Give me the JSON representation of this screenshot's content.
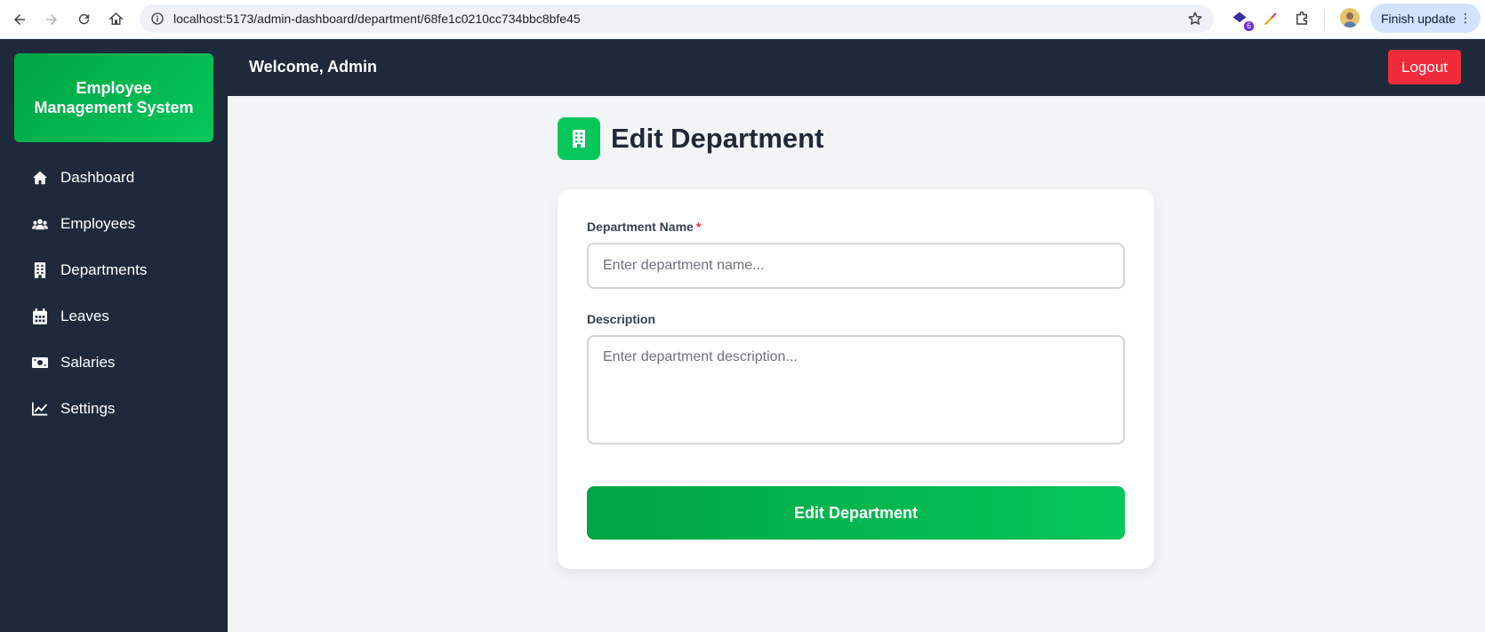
{
  "browser": {
    "url": "localhost:5173/admin-dashboard/department/68fe1c0210cc734bbc8bfe45",
    "extension_badge": "6",
    "update_button": "Finish update"
  },
  "sidebar": {
    "brand": "Employee Management System",
    "items": [
      {
        "label": "Dashboard",
        "icon": "home-icon"
      },
      {
        "label": "Employees",
        "icon": "users-icon"
      },
      {
        "label": "Departments",
        "icon": "building-icon"
      },
      {
        "label": "Leaves",
        "icon": "calendar-icon"
      },
      {
        "label": "Salaries",
        "icon": "money-bill-icon"
      },
      {
        "label": "Settings",
        "icon": "chart-line-icon"
      }
    ]
  },
  "header": {
    "welcome": "Welcome, Admin",
    "logout": "Logout"
  },
  "page": {
    "title": "Edit Department",
    "icon": "building-icon"
  },
  "form": {
    "name_label": "Department Name",
    "required_mark": "*",
    "name_placeholder": "Enter department name...",
    "name_value": "",
    "description_label": "Description",
    "description_placeholder": "Enter department description...",
    "description_value": "",
    "submit_label": "Edit Department"
  },
  "colors": {
    "accent_green": "#05c75a",
    "sidebar_bg": "#1e293b",
    "logout_red": "#ef2b3a"
  }
}
